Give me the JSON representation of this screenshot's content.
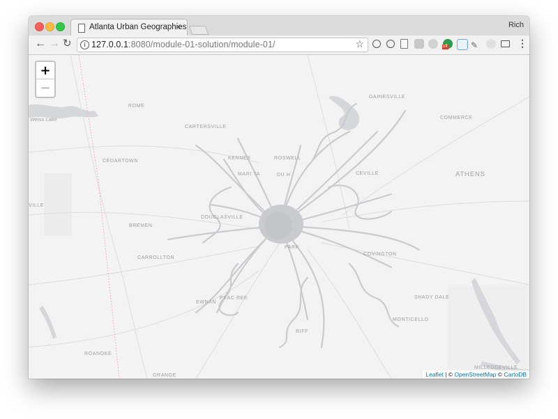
{
  "browser": {
    "tab_title": "Atlanta Urban Geographies",
    "tab_close": "×",
    "profile_name": "Rich",
    "url_host": "127.0.0.1",
    "url_path": ":8080/module-01-solution/module-01/",
    "back_icon": "arrow-left-icon",
    "forward_icon": "arrow-right-icon",
    "reload_icon": "reload-icon",
    "star_icon": "star-icon",
    "menu_icon": "kebab-menu-icon",
    "extension_badge": "off"
  },
  "map": {
    "zoom_in": "+",
    "zoom_out": "−",
    "places": {
      "gainesville": "GAINESVILLE",
      "rome": "ROME",
      "weiss_lake": "Weiss Lake",
      "commerce": "COMMERCE",
      "cartersville": "CARTERSVILLE",
      "cedartown": "CEDARTOWN",
      "kennesaw": "KENNES",
      "roswell": "ROSWELL",
      "marietta": "MARI  TA",
      "duluth": "DU    H",
      "lawrenceville": "CEVILLE",
      "athens": "ATHENS",
      "piedmont": "VILLE",
      "douglasville": "DOUGLASVILLE",
      "bremen": "BREMEN",
      "carrollton": "CARROLLTON",
      "covington": "COVINGTON",
      "peachtree": "PEAC   REE",
      "newnan": "EWNAN",
      "shady_dale": "SHADY DALE",
      "monticello": "MONTICELLO",
      "griffin": "RIFF",
      "roanoke": "ROANOKE",
      "lagrange": "GRANGE",
      "milledgeville": "MILLEDGEVILLE",
      "forest_park": "PARK"
    },
    "attribution": {
      "leaflet": "Leaflet",
      "sep": " | © ",
      "osm": "OpenStreetMap",
      "mid": " © ",
      "carto": "CartoDB"
    },
    "colors": {
      "network": "#c9cbcf",
      "water": "#d5d7db",
      "road": "#e2e2e2",
      "rail": "#f2b3b3"
    }
  }
}
